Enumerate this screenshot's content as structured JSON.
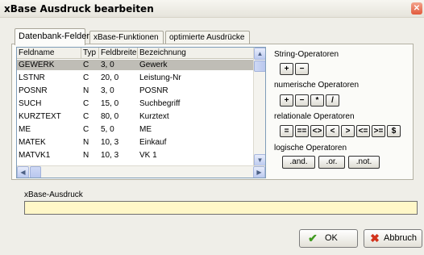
{
  "window": {
    "title": "xBase Ausdruck bearbeiten",
    "close_icon": "close-icon"
  },
  "tabs": [
    {
      "label": "Datenbank-Felder",
      "active": true
    },
    {
      "label": "xBase-Funktionen",
      "active": false
    },
    {
      "label": "optimierte Ausdrücke",
      "active": false
    }
  ],
  "fields_table": {
    "columns": [
      "Feldname",
      "Typ",
      "Feldbreite",
      "Bezeichnung"
    ],
    "rows": [
      [
        "GEWERK",
        "C",
        "3, 0",
        "Gewerk"
      ],
      [
        "LSTNR",
        "C",
        "20, 0",
        "Leistung-Nr"
      ],
      [
        "POSNR",
        "N",
        "3, 0",
        "POSNR"
      ],
      [
        "SUCH",
        "C",
        "15, 0",
        "Suchbegriff"
      ],
      [
        "KURZTEXT",
        "C",
        "80, 0",
        "Kurztext"
      ],
      [
        "ME",
        "C",
        "5, 0",
        "ME"
      ],
      [
        "MATEK",
        "N",
        "10, 3",
        "Einkauf"
      ],
      [
        "MATVK1",
        "N",
        "10, 3",
        "VK 1"
      ]
    ],
    "selected_row": 0
  },
  "operators": {
    "string_label": "String-Operatoren",
    "string_ops": [
      "+",
      "−"
    ],
    "numeric_label": "numerische Operatoren",
    "numeric_ops": [
      "+",
      "−",
      "*",
      "/"
    ],
    "relational_label": "relationale Operatoren",
    "relational_ops": [
      "=",
      "==",
      "<>",
      "<",
      ">",
      "<=",
      ">=",
      "$"
    ],
    "logical_label": "logische Operatoren",
    "logical_ops": [
      ".and.",
      ".or.",
      ".not."
    ]
  },
  "expression": {
    "label": "xBase-Ausdruck",
    "value": ""
  },
  "buttons": {
    "ok_label": "OK",
    "cancel_label": "Abbruch",
    "ok_icon": "check-icon",
    "cancel_icon": "x-icon"
  },
  "colors": {
    "expression_bg": "#fff7c8",
    "selected_row": "#bfbdb6",
    "ok_icon": "#3f9a1e",
    "cancel_icon": "#d2321a"
  }
}
